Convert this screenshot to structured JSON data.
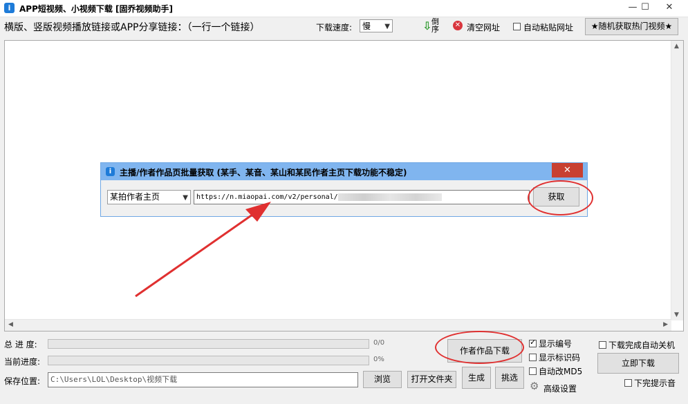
{
  "window": {
    "title": "APP短视频、小视频下载 [固乔视频助手]",
    "icon_glyph": "i",
    "minimize_glyph": "—",
    "maximize_glyph": "☐",
    "close_glyph": "✕"
  },
  "toolbar": {
    "instruction": "横版、竖版视频播放链接或APP分享链接：（一行一个链接）",
    "speed_label": "下载速度:",
    "speed_value": "慢",
    "reverse_label_1": "倒",
    "reverse_label_2": "序",
    "clear_label": "清空网址",
    "auto_paste_label": "自动粘贴网址",
    "random_hot_label": "★随机获取热门视频★"
  },
  "dialog": {
    "title": "主播/作者作品页批量获取 (某手、某音、某山和某民作者主页下载功能不稳定)",
    "source_value": "某拍作者主页",
    "url_value": "https://n.miaopai.com/v2/personal/",
    "fetch_label": "获取"
  },
  "bottom": {
    "total_progress_label": "总 进 度:",
    "total_progress_value": "0/0",
    "total_progress_fraction": 0,
    "current_progress_label": "当前进度:",
    "current_progress_value": "0%",
    "current_progress_fraction": 0,
    "save_location_label": "保存位置:",
    "save_path": "C:\\Users\\LOL\\Desktop\\视频下载",
    "browse_label": "浏览",
    "open_folder_label": "打开文件夹",
    "author_download_label": "作者作品下载",
    "generate_label": "生成",
    "pick_label": "挑选",
    "show_number_label": "显示编号",
    "show_number_checked": true,
    "show_id_label": "显示标识码",
    "show_id_checked": false,
    "auto_md5_label": "自动改MD5",
    "auto_md5_checked": false,
    "advanced_label": "高级设置",
    "shutdown_label": "下载完成自动关机",
    "download_now_label": "立即下载",
    "sound_label": "下完提示音"
  },
  "colors": {
    "annotation_red": "#e03030",
    "dialog_title": "#80b5ef",
    "dialog_close": "#c84031"
  }
}
